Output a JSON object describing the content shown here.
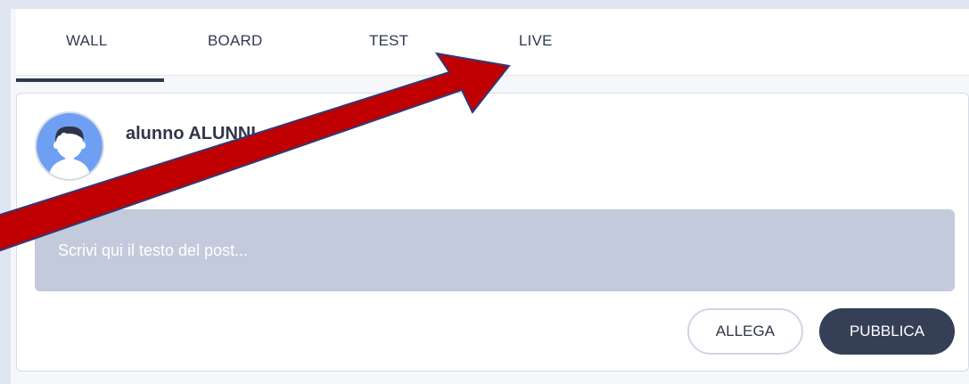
{
  "tabs": [
    {
      "label": "WALL",
      "active": true
    },
    {
      "label": "BOARD",
      "active": false
    },
    {
      "label": "TEST",
      "active": false
    },
    {
      "label": "LIVE",
      "active": false
    }
  ],
  "post": {
    "author": "alunno ALUNNI",
    "input_placeholder": "Scrivi qui il testo del post...",
    "attach_label": "ALLEGA",
    "publish_label": "PUBBLICA"
  },
  "icons": {
    "avatar": "user-avatar-icon",
    "annotation": "red-arrow-icon"
  },
  "colors": {
    "active_tab_underline": "#2e3a52",
    "publish_button": "#353f56",
    "input_background": "#c2cadb",
    "annotation_arrow": "#c00000"
  }
}
